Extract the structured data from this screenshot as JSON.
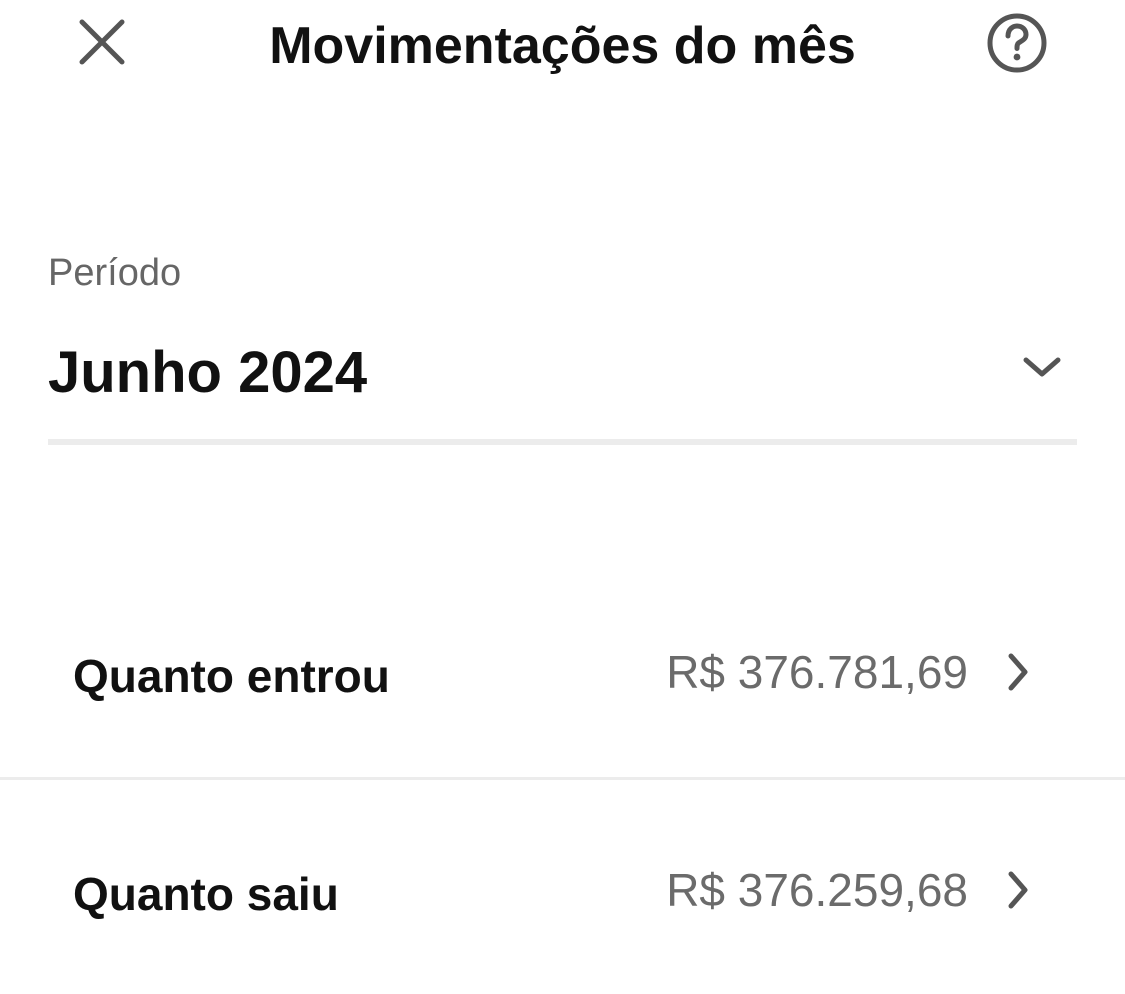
{
  "header": {
    "title": "Movimentações do mês",
    "close_icon": "close-icon",
    "help_icon": "help-circle-icon"
  },
  "period": {
    "label": "Período",
    "value": "Junho 2024",
    "dropdown_icon": "chevron-down-icon"
  },
  "rows": [
    {
      "label": "Quanto entrou",
      "value": "R$ 376.781,69",
      "icon": "chevron-right-icon"
    },
    {
      "label": "Quanto saiu",
      "value": "R$ 376.259,68",
      "icon": "chevron-right-icon"
    }
  ],
  "colors": {
    "text_primary": "#111111",
    "text_secondary": "#6b6b6b",
    "divider": "#ececec",
    "icon": "#555555"
  }
}
